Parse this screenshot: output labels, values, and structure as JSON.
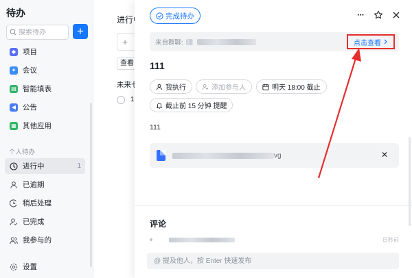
{
  "sidebar": {
    "title": "待办",
    "search_placeholder": "搜索待办",
    "add_label": "+",
    "apps": [
      {
        "label": "项目",
        "icon": "layers-icon",
        "color": "#5b6ff5"
      },
      {
        "label": "会议",
        "icon": "meeting-icon",
        "color": "#3a8ef6"
      },
      {
        "label": "智能填表",
        "icon": "form-icon",
        "color": "#34b36b"
      },
      {
        "label": "公告",
        "icon": "announcement-icon",
        "color": "#4a7cf0"
      },
      {
        "label": "其他应用",
        "icon": "apps-grid-icon",
        "color": "#2fb567"
      }
    ],
    "section_label": "个人待办",
    "personal": [
      {
        "label": "进行中",
        "icon": "clock-icon",
        "count": "1"
      },
      {
        "label": "已逾期",
        "icon": "person-icon"
      },
      {
        "label": "稍后处理",
        "icon": "later-icon"
      },
      {
        "label": "已完成",
        "icon": "person-check-icon"
      },
      {
        "label": "我参与的",
        "icon": "group-icon"
      }
    ],
    "settings_label": "设置"
  },
  "middle": {
    "title": "进行中",
    "add_symbol": "+",
    "view_label": "查看",
    "future_label": "未来七",
    "item_partial": "1"
  },
  "panel": {
    "complete_label": "完成待办",
    "more_label": "···",
    "source_label": "来自群聊:",
    "view_link": "点击查看",
    "task_title": "111",
    "chips": {
      "executor": "我执行",
      "add_participant": "添加参与人",
      "due": "明天 18:00 截止",
      "reminder": "截止前 15 分钟 提醒"
    },
    "description": "111",
    "attachment_ext": "vg",
    "close_label": "✕",
    "comment_title": "评论",
    "activity_time": "日秒前",
    "comment_placeholder": "@ 提及他人，按 Enter 快速发布"
  },
  "colors": {
    "accent": "#1677ff",
    "highlight_red": "#e62e2e"
  }
}
